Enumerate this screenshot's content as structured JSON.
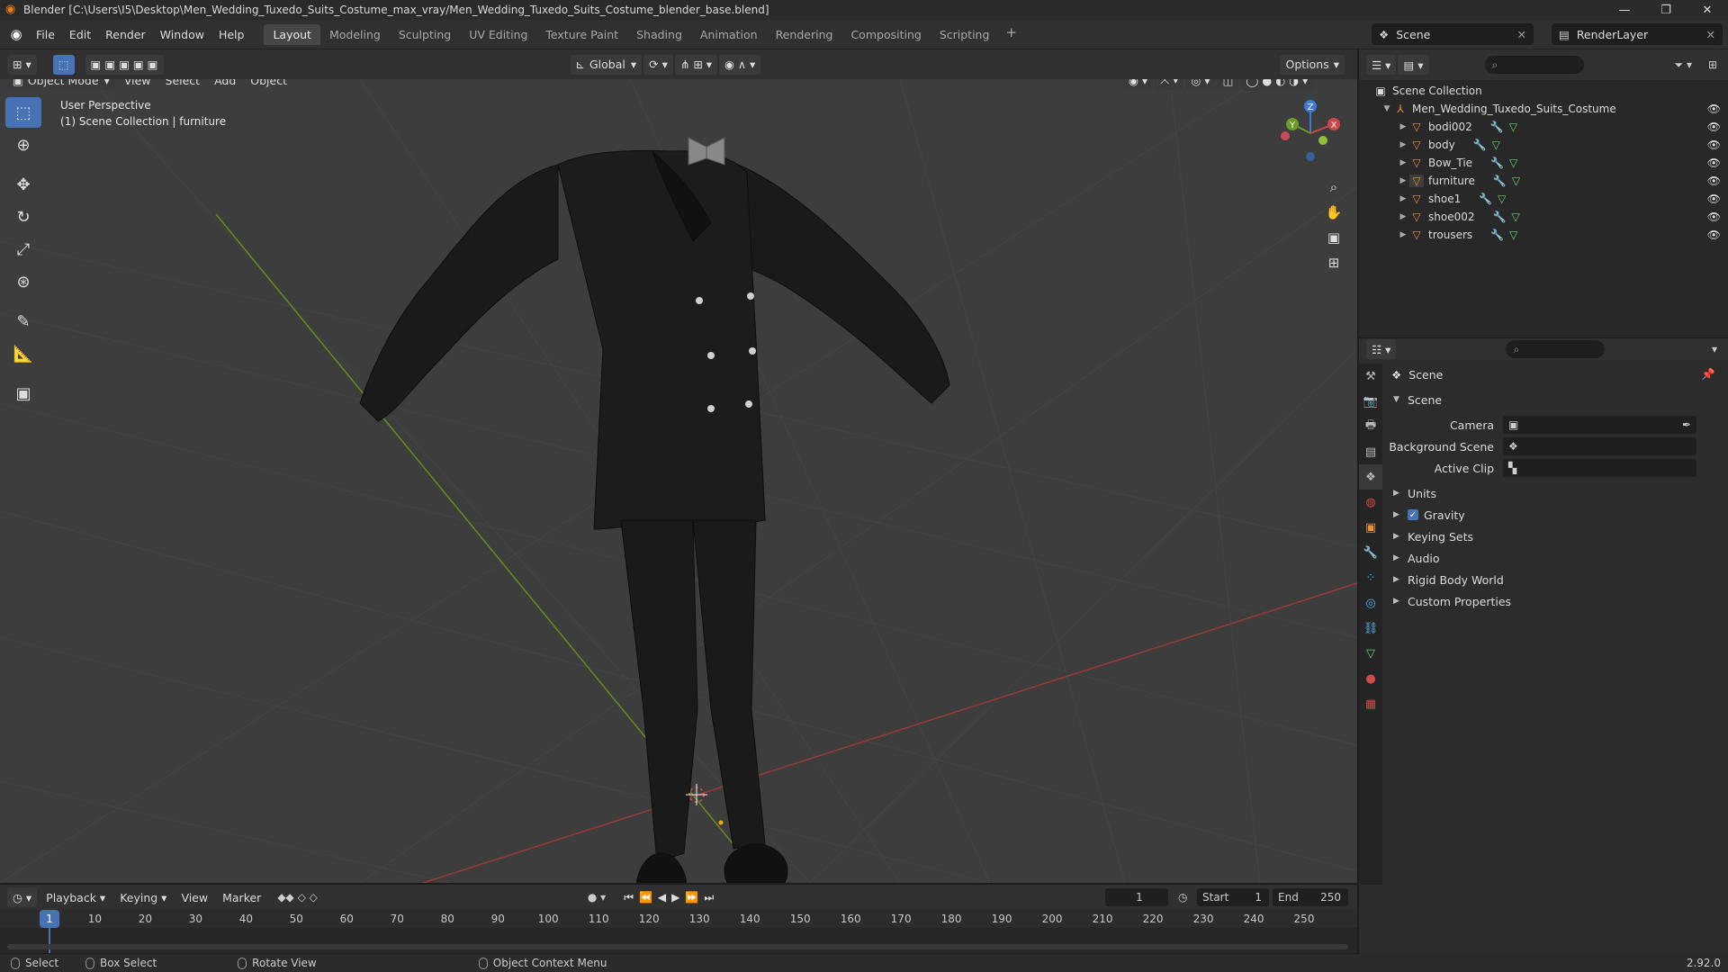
{
  "window": {
    "title": "Blender [C:\\Users\\I5\\Desktop\\Men_Wedding_Tuxedo_Suits_Costume_max_vray/Men_Wedding_Tuxedo_Suits_Costume_blender_base.blend]",
    "minimize": "—",
    "maximize": "❐",
    "close": "✕"
  },
  "menu": {
    "file": "File",
    "edit": "Edit",
    "render": "Render",
    "window": "Window",
    "help": "Help"
  },
  "workspaces": [
    "Layout",
    "Modeling",
    "Sculpting",
    "UV Editing",
    "Texture Paint",
    "Shading",
    "Animation",
    "Rendering",
    "Compositing",
    "Scripting"
  ],
  "active_workspace": "Layout",
  "scene_name": "Scene",
  "view_layer": "RenderLayer",
  "viewport_header": {
    "mode": "Object Mode",
    "view": "View",
    "select": "Select",
    "add": "Add",
    "object": "Object",
    "orientation": "Global",
    "options": "Options"
  },
  "viewport": {
    "perspective": "User Perspective",
    "collection_info": "(1) Scene Collection | furniture",
    "gizmo": {
      "z": "Z",
      "y": "Y",
      "x": "X"
    }
  },
  "outliner": {
    "root": "Scene Collection",
    "collection": "Men_Wedding_Tuxedo_Suits_Costume",
    "objects": [
      "bodi002",
      "body",
      "Bow_Tie",
      "furniture",
      "shoe1",
      "shoe002",
      "trousers"
    ]
  },
  "properties": {
    "context": "Scene",
    "section": "Scene",
    "camera_label": "Camera",
    "background_scene_label": "Background Scene",
    "active_clip_label": "Active Clip",
    "subsections": [
      "Units",
      "Gravity",
      "Keying Sets",
      "Audio",
      "Rigid Body World",
      "Custom Properties"
    ],
    "gravity_checked": true
  },
  "timeline": {
    "playback": "Playback",
    "keying": "Keying",
    "view": "View",
    "marker": "Marker",
    "current_frame": "1",
    "start_label": "Start",
    "start": "1",
    "end_label": "End",
    "end": "250",
    "ticks": [
      "1",
      "10",
      "20",
      "30",
      "40",
      "50",
      "60",
      "70",
      "80",
      "90",
      "100",
      "110",
      "120",
      "130",
      "140",
      "150",
      "160",
      "170",
      "180",
      "190",
      "200",
      "210",
      "220",
      "230",
      "240",
      "250"
    ]
  },
  "statusbar": {
    "select": "Select",
    "box_select": "Box Select",
    "rotate_view": "Rotate View",
    "context_menu": "Object Context Menu",
    "version": "2.92.0"
  }
}
